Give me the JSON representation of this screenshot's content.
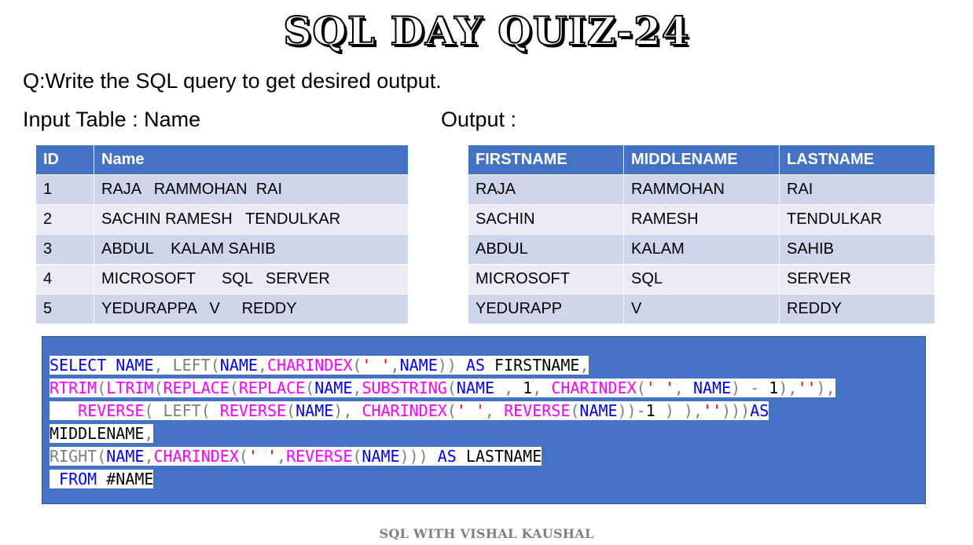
{
  "title": "SQL DAY QUIZ-24",
  "question": "Q:Write the SQL query to get desired output.",
  "input_label": "Input Table : Name",
  "output_label": "Output :",
  "input_table": {
    "headers": [
      "ID",
      "Name"
    ],
    "rows": [
      [
        "1",
        "RAJA   RAMMOHAN  RAI"
      ],
      [
        "2",
        "SACHIN RAMESH   TENDULKAR"
      ],
      [
        "3",
        "ABDUL    KALAM SAHIB"
      ],
      [
        "4",
        "MICROSOFT      SQL   SERVER"
      ],
      [
        "5",
        "YEDURAPPA   V     REDDY"
      ]
    ]
  },
  "output_table": {
    "headers": [
      "FIRSTNAME",
      "MIDDLENAME",
      "LASTNAME"
    ],
    "rows": [
      [
        "RAJA",
        "RAMMOHAN",
        "RAI"
      ],
      [
        "SACHIN",
        "RAMESH",
        "TENDULKAR"
      ],
      [
        "ABDUL",
        "KALAM",
        "SAHIB"
      ],
      [
        "MICROSOFT",
        "SQL",
        "SERVER"
      ],
      [
        "YEDURAPP",
        "V",
        "REDDY"
      ]
    ]
  },
  "code_lines": [
    [
      [
        "kw",
        "SELECT"
      ],
      [
        "tx",
        " "
      ],
      [
        "kw",
        "NAME"
      ],
      [
        "gr",
        ", "
      ],
      [
        "gr",
        "LEFT"
      ],
      [
        "gr",
        "("
      ],
      [
        "kw",
        "NAME"
      ],
      [
        "gr",
        ","
      ],
      [
        "fn",
        "CHARINDEX"
      ],
      [
        "gr",
        "("
      ],
      [
        "str",
        "' '"
      ],
      [
        "gr",
        ","
      ],
      [
        "kw",
        "NAME"
      ],
      [
        "gr",
        "))"
      ],
      [
        "tx",
        " "
      ],
      [
        "kw",
        "AS"
      ],
      [
        "tx",
        " FIRSTNAME"
      ],
      [
        "gr",
        ","
      ]
    ],
    [
      [
        "fn",
        "RTRIM"
      ],
      [
        "gr",
        "("
      ],
      [
        "fn",
        "LTRIM"
      ],
      [
        "gr",
        "("
      ],
      [
        "fn",
        "REPLACE"
      ],
      [
        "gr",
        "("
      ],
      [
        "fn",
        "REPLACE"
      ],
      [
        "gr",
        "("
      ],
      [
        "kw",
        "NAME"
      ],
      [
        "gr",
        ","
      ],
      [
        "fn",
        "SUBSTRING"
      ],
      [
        "gr",
        "("
      ],
      [
        "kw",
        "NAME"
      ],
      [
        "tx",
        " "
      ],
      [
        "gr",
        ","
      ],
      [
        "tx",
        " 1"
      ],
      [
        "gr",
        ","
      ],
      [
        "tx",
        " "
      ],
      [
        "fn",
        "CHARINDEX"
      ],
      [
        "gr",
        "("
      ],
      [
        "str",
        "' '"
      ],
      [
        "gr",
        ","
      ],
      [
        "tx",
        " "
      ],
      [
        "kw",
        "NAME"
      ],
      [
        "gr",
        ")"
      ],
      [
        "tx",
        " "
      ],
      [
        "gr",
        "-"
      ],
      [
        "tx",
        " 1"
      ],
      [
        "gr",
        "),"
      ],
      [
        "str",
        "''"
      ],
      [
        "gr",
        "),"
      ]
    ],
    [
      [
        "tx",
        "   "
      ],
      [
        "fn",
        "REVERSE"
      ],
      [
        "gr",
        "("
      ],
      [
        "tx",
        " "
      ],
      [
        "gr",
        "LEFT"
      ],
      [
        "gr",
        "("
      ],
      [
        "tx",
        " "
      ],
      [
        "fn",
        "REVERSE"
      ],
      [
        "gr",
        "("
      ],
      [
        "kw",
        "NAME"
      ],
      [
        "gr",
        "),"
      ],
      [
        "tx",
        " "
      ],
      [
        "fn",
        "CHARINDEX"
      ],
      [
        "gr",
        "("
      ],
      [
        "str",
        "' '"
      ],
      [
        "gr",
        ","
      ],
      [
        "tx",
        " "
      ],
      [
        "fn",
        "REVERSE"
      ],
      [
        "gr",
        "("
      ],
      [
        "kw",
        "NAME"
      ],
      [
        "gr",
        "))-"
      ],
      [
        "tx",
        "1 "
      ],
      [
        "gr",
        ")"
      ],
      [
        "tx",
        " "
      ],
      [
        "gr",
        "),"
      ],
      [
        "str",
        "''"
      ],
      [
        "gr",
        ")))"
      ],
      [
        "kw",
        "AS"
      ]
    ],
    [
      [
        "tx",
        "MIDDLENAME"
      ],
      [
        "gr",
        ","
      ]
    ],
    [
      [
        "gr",
        "RIGHT"
      ],
      [
        "gr",
        "("
      ],
      [
        "kw",
        "NAME"
      ],
      [
        "gr",
        ","
      ],
      [
        "fn",
        "CHARINDEX"
      ],
      [
        "gr",
        "("
      ],
      [
        "str",
        "' '"
      ],
      [
        "gr",
        ","
      ],
      [
        "fn",
        "REVERSE"
      ],
      [
        "gr",
        "("
      ],
      [
        "kw",
        "NAME"
      ],
      [
        "gr",
        ")))"
      ],
      [
        "tx",
        " "
      ],
      [
        "kw",
        "AS"
      ],
      [
        "tx",
        " LASTNAME"
      ]
    ],
    [
      [
        "tx",
        " "
      ],
      [
        "kw",
        "FROM"
      ],
      [
        "tx",
        " #NAME"
      ]
    ]
  ],
  "footer": "SQL WITH VISHAL KAUSHAL"
}
